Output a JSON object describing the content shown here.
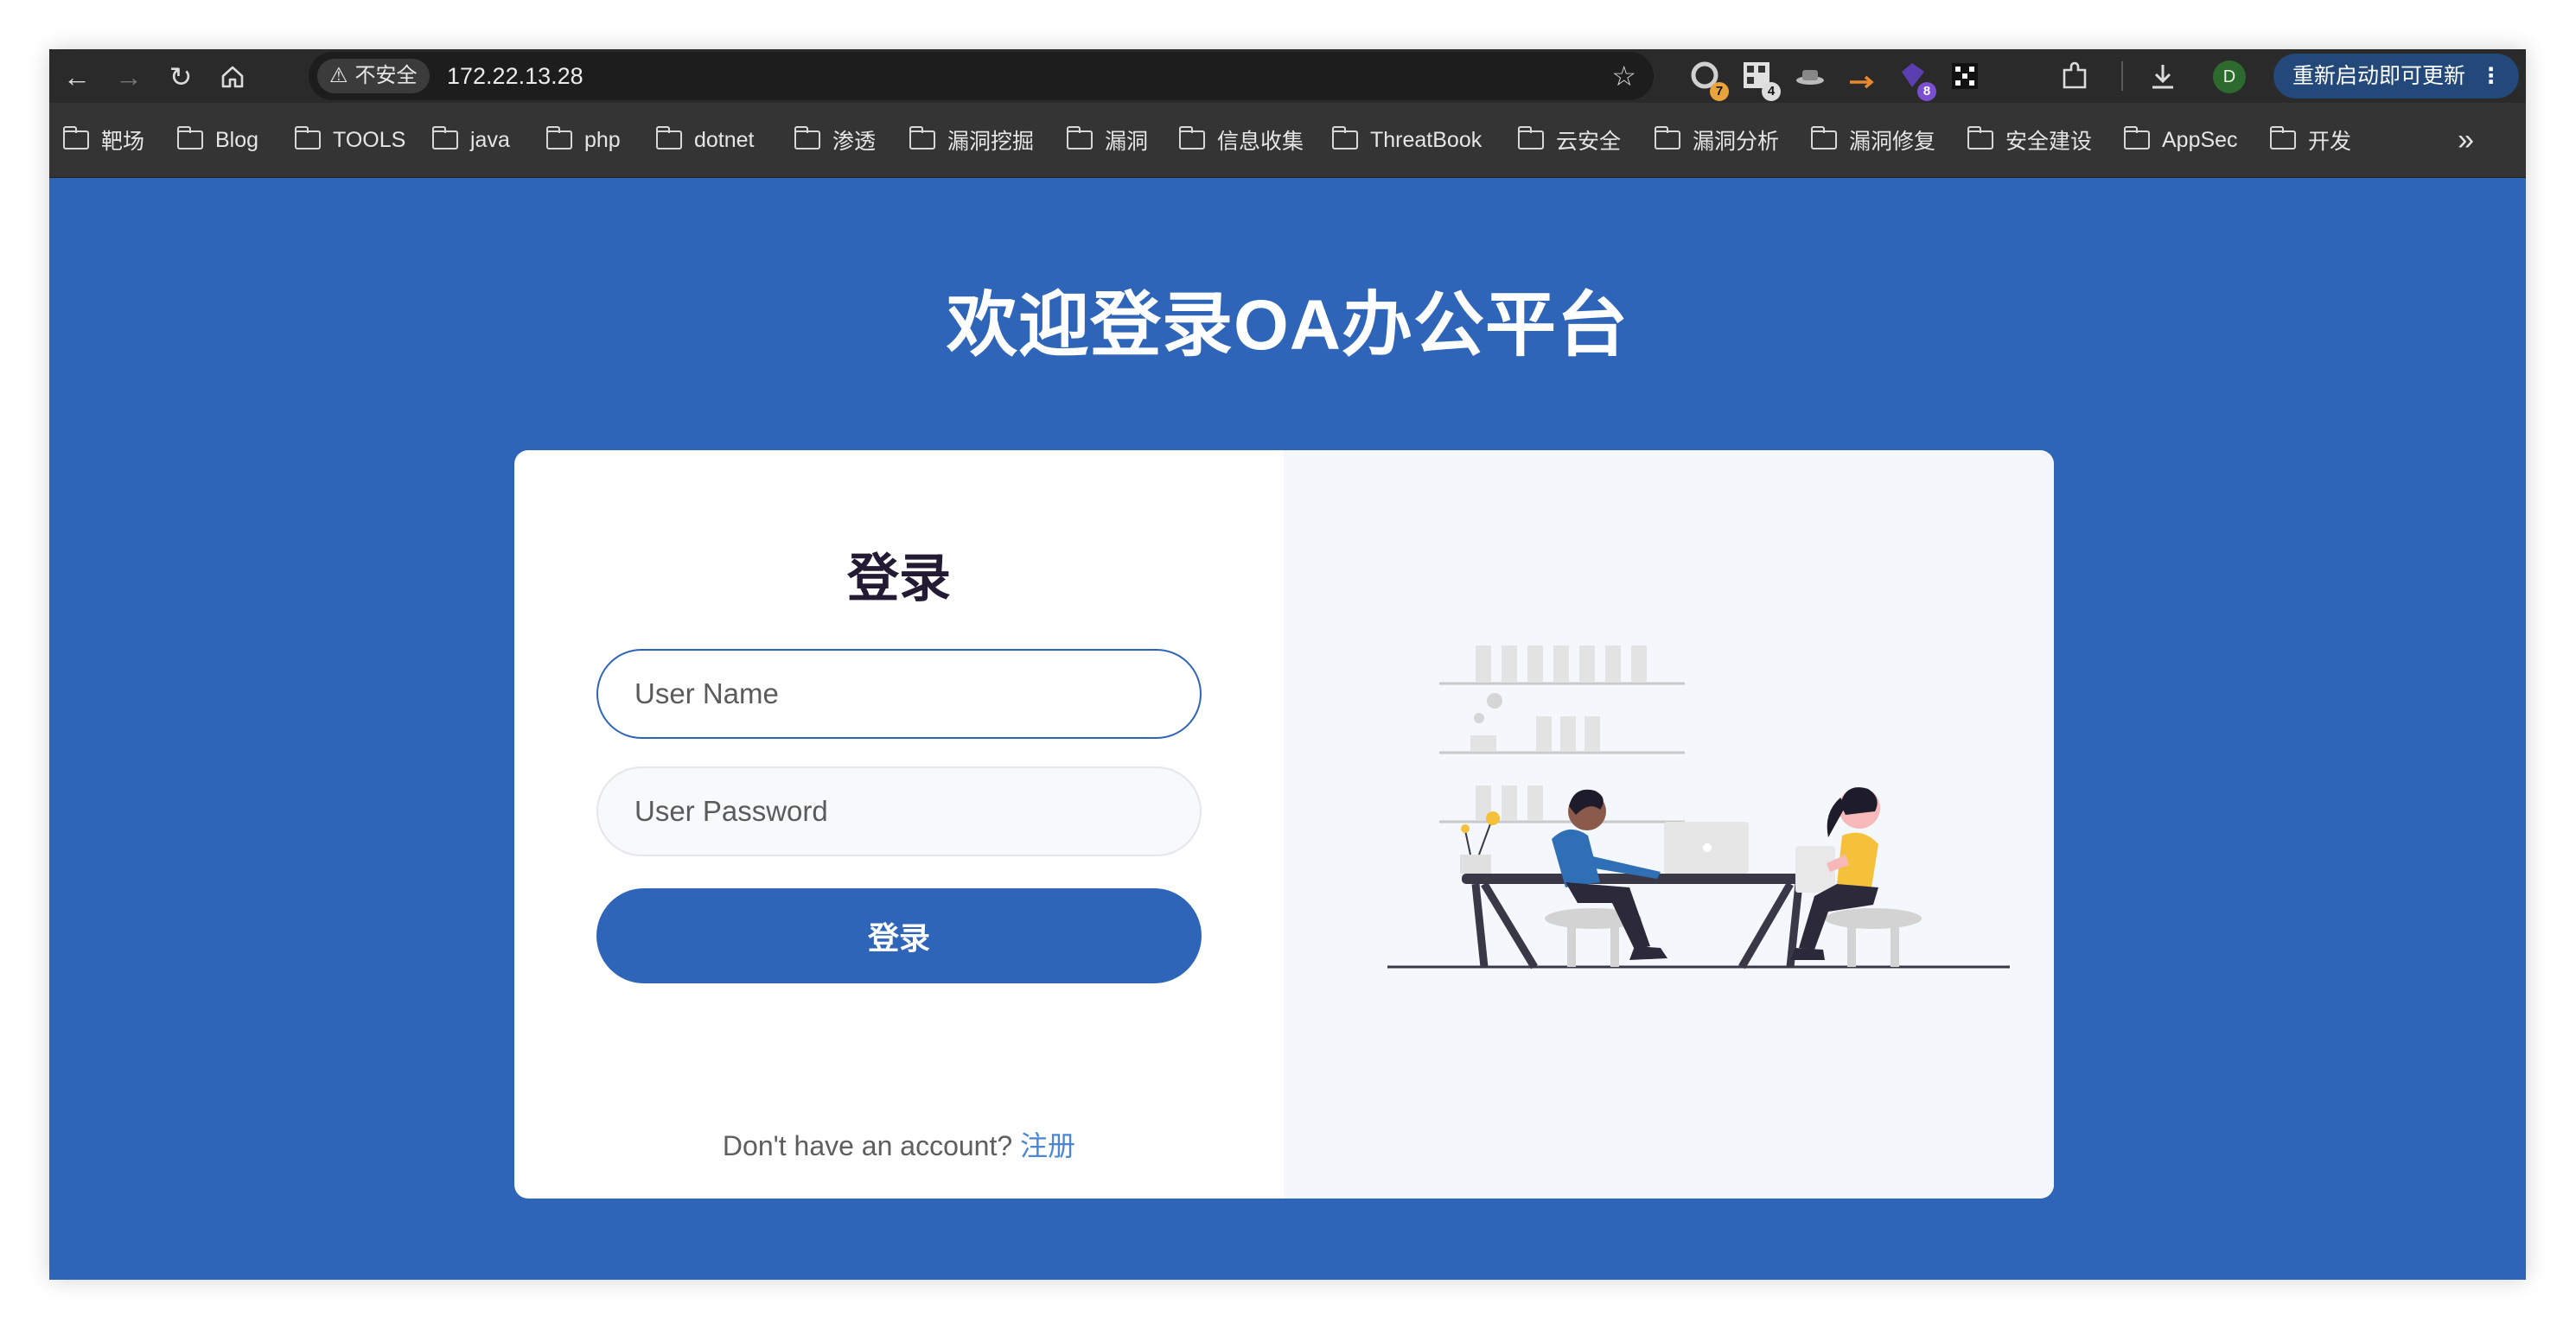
{
  "browser": {
    "security_label": "不安全",
    "url": "172.22.13.28",
    "extensions": [
      {
        "icon": "extension-circle-icon",
        "badge": "7",
        "badge_color": "#e8a33d"
      },
      {
        "icon": "extension-qr-icon",
        "badge": "4",
        "badge_color": "#dddddd"
      },
      {
        "icon": "extension-hat-icon",
        "badge": "",
        "badge_color": ""
      },
      {
        "icon": "extension-arrow-icon",
        "badge": "",
        "badge_color": ""
      },
      {
        "icon": "extension-gem-icon",
        "badge": "8",
        "badge_color": "#7b4fd0"
      },
      {
        "icon": "extension-pattern-icon",
        "badge": "",
        "badge_color": ""
      }
    ],
    "profile_initial": "D",
    "update_label": "重新启动即可更新",
    "bookmarks": [
      "靶场",
      "Blog",
      "TOOLS",
      "java",
      "php",
      "dotnet",
      "渗透",
      "漏洞挖掘",
      "漏洞",
      "信息收集",
      "ThreatBook",
      "云安全",
      "漏洞分析",
      "漏洞修复",
      "安全建设",
      "AppSec",
      "开发"
    ],
    "more_bookmarks": "»"
  },
  "page": {
    "title": "欢迎登录OA办公平台",
    "login": {
      "heading": "登录",
      "username_placeholder": "User Name",
      "password_placeholder": "User Password",
      "submit_label": "登录",
      "signup_prompt": "Don't have an account?",
      "signup_link": "注册"
    }
  },
  "colors": {
    "brand_blue": "#2e65b8",
    "illustration_blue": "#2f6fb6",
    "illustration_yellow": "#f6c13a",
    "illustration_dark": "#3a3847"
  }
}
